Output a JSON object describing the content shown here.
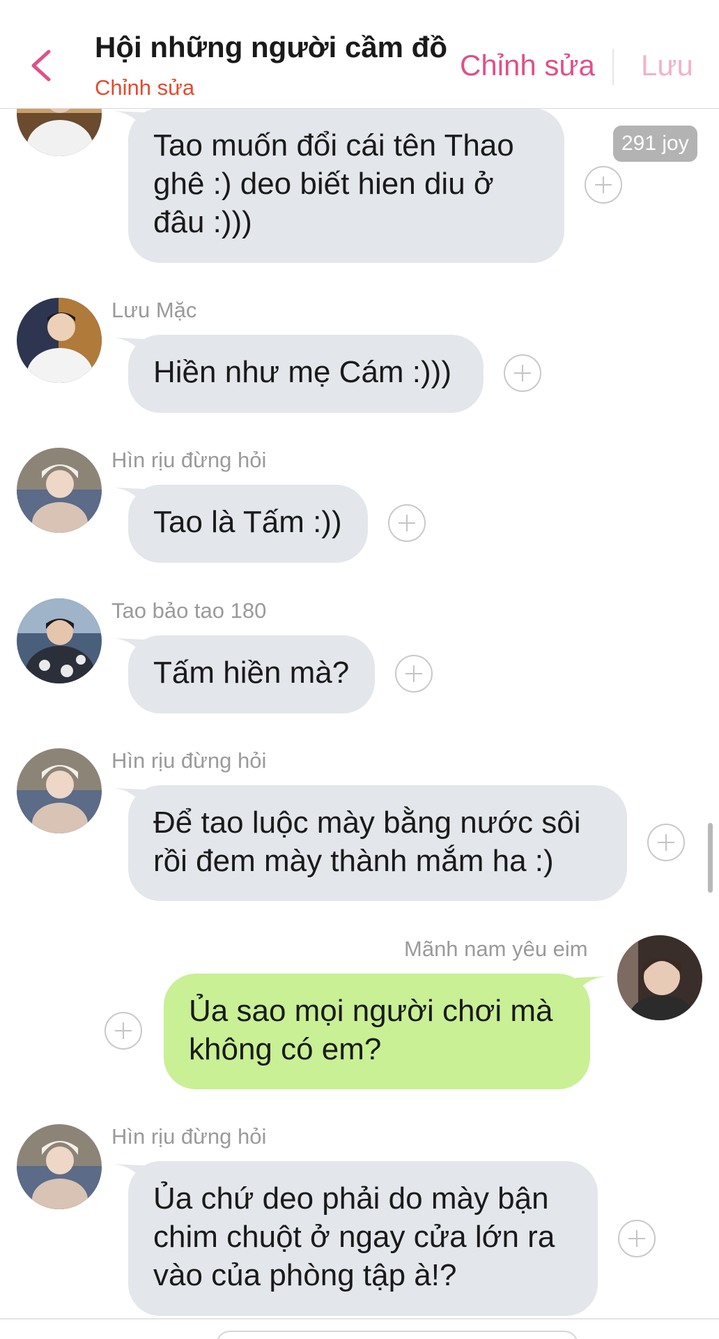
{
  "header": {
    "title": "Hội những người cầm đồ",
    "subtitle": "Chỉnh sửa",
    "edit_label": "Chỉnh sửa",
    "save_label": "Lưu",
    "accent_color": "#e0508a"
  },
  "joy_badge": "291 joy",
  "messages": [
    {
      "sender": "",
      "text": "Tao muốn đổi cái tên Thao\nghê :) deo biết hien diu ở\nđâu :)))",
      "direction": "incoming"
    },
    {
      "sender": "Lưu Mặc",
      "text": "Hiền như mẹ Cám :)))",
      "direction": "incoming"
    },
    {
      "sender": "Hìn rịu đừng hỏi",
      "text": "Tao là Tấm :))",
      "direction": "incoming"
    },
    {
      "sender": "Tao bảo tao 180",
      "text": "Tấm hiền mà?",
      "direction": "incoming"
    },
    {
      "sender": "Hìn rịu đừng hỏi",
      "text": "Để tao luộc mày bằng nước sôi\nrồi đem mày thành mắm ha :)",
      "direction": "incoming"
    },
    {
      "sender": "Mãnh nam yêu eim",
      "text": "Ủa sao mọi người chơi mà\nkhông có em?",
      "direction": "outgoing"
    },
    {
      "sender": "Hìn rịu đừng hỏi",
      "text": "Ủa chứ deo phải do mày bận\nchim chuột ở ngay cửa lớn ra\nvào của phòng tập à!?",
      "direction": "incoming"
    }
  ],
  "colors": {
    "incoming_bubble": "#e3e6ea",
    "outgoing_bubble": "#c9f095",
    "sender_name": "#9a9a9a"
  }
}
